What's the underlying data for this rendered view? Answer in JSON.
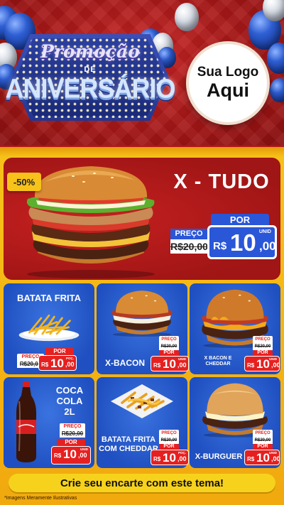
{
  "header": {
    "promo_line": "Promoção",
    "de_line": "DE",
    "anniversary_line": "ANIVERSÁRIO",
    "logo_line1": "Sua Logo",
    "logo_line2": "Aqui"
  },
  "main_offer": {
    "discount": "-50%",
    "name": "X - TUDO",
    "por_label": "POR",
    "preco_label": "PREÇO",
    "old_price": "R$20,00",
    "currency": "R$",
    "price_int": "10",
    "price_cents": ",00",
    "unit": "UNID"
  },
  "grid_items": [
    {
      "name": "BATATA FRITA",
      "preco_label": "PREÇO",
      "old_price": "R$20,00",
      "por_label": "POR",
      "currency": "R$",
      "price_int": "10",
      "price_cents": ",00",
      "unit": "POÇ."
    },
    {
      "name": "X-BACON",
      "preco_label": "PREÇO",
      "old_price": "R$20,00",
      "por_label": "POR",
      "currency": "R$",
      "price_int": "10",
      "price_cents": ",00",
      "unit": "UNID"
    },
    {
      "name": "X BACON E CHEDDAR",
      "preco_label": "PREÇO",
      "old_price": "R$20,00",
      "por_label": "POR",
      "currency": "R$",
      "price_int": "10",
      "price_cents": ",00",
      "unit": "UNID"
    },
    {
      "name": "COCA COLA 2L",
      "preco_label": "PREÇO",
      "old_price": "R$20,00",
      "por_label": "POR",
      "currency": "R$",
      "price_int": "10",
      "price_cents": ",00",
      "unit": "UNID"
    },
    {
      "name": "BATATA FRITA COM CHEDDAR",
      "preco_label": "PREÇO",
      "old_price": "R$20,00",
      "por_label": "POR",
      "currency": "R$",
      "price_int": "10",
      "price_cents": ",00",
      "unit": "POÇ."
    },
    {
      "name": "X-BURGUER",
      "preco_label": "PREÇO",
      "old_price": "R$20,00",
      "por_label": "POR",
      "currency": "R$",
      "price_int": "10",
      "price_cents": ",00",
      "unit": "UNID"
    }
  ],
  "footer": {
    "cta": "Crie seu encarte com este tema!",
    "disclaimer": "*Imagens Meramente Ilustrativas"
  },
  "colors": {
    "header_red": "#b01a1a",
    "frame_yellow": "#f7c21a",
    "card_blue": "#2a5fd0",
    "price_red": "#e62020",
    "price_blue": "#2a56d8"
  }
}
